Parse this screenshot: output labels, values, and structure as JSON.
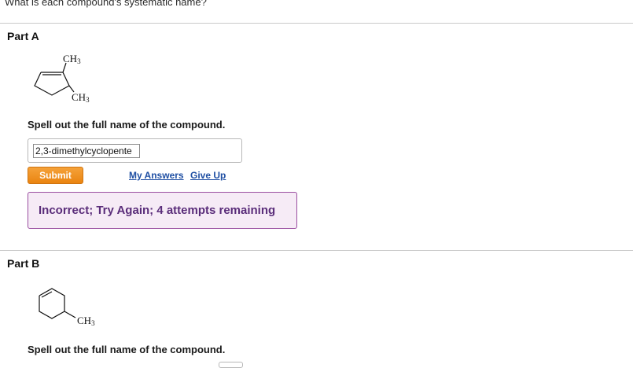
{
  "question": "What is each compound's systematic name?",
  "part_a": {
    "title": "Part A",
    "structure": {
      "top_substituent": "CH",
      "top_subscript": "3",
      "bottom_substituent": "CH",
      "bottom_subscript": "3"
    },
    "prompt": "Spell out the full name of the compound.",
    "answer_value": "2,3-dimethylcyclopente",
    "submit_label": "Submit",
    "my_answers_label": "My Answers",
    "give_up_label": "Give Up",
    "feedback": "Incorrect; Try Again; 4 attempts remaining"
  },
  "part_b": {
    "title": "Part B",
    "structure": {
      "substituent": "CH",
      "subscript": "3"
    },
    "prompt": "Spell out the full name of the compound."
  },
  "colors": {
    "submit": "#ea8410",
    "link": "#1f4fa3",
    "feedback_bg": "#f6ebf6",
    "feedback_border": "#9a4ea0",
    "feedback_text": "#5a2d7a"
  }
}
